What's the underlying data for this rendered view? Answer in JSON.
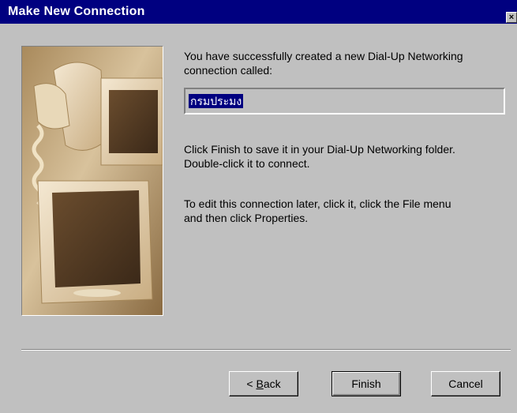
{
  "window": {
    "title": "Make New Connection",
    "close_glyph": "×"
  },
  "main": {
    "intro_line1": "You have successfully created a new Dial-Up Networking",
    "intro_line2": "connection called:",
    "connection_name": "กรมประมง",
    "finish_line1": "Click Finish to save it in your Dial-Up Networking folder.",
    "finish_line2": "Double-click it to connect.",
    "edit_line1": "To edit this connection later, click it, click the File menu",
    "edit_line2": "and then click Properties."
  },
  "buttons": {
    "back_prefix": "< ",
    "back_mnemonic": "B",
    "back_rest": "ack",
    "finish": "Finish",
    "cancel": "Cancel"
  },
  "image": {
    "description_icon": "computer-monitors-illustration"
  },
  "colors": {
    "titlebar": "#000080",
    "face": "#c0c0c0",
    "selection": "#000080"
  }
}
